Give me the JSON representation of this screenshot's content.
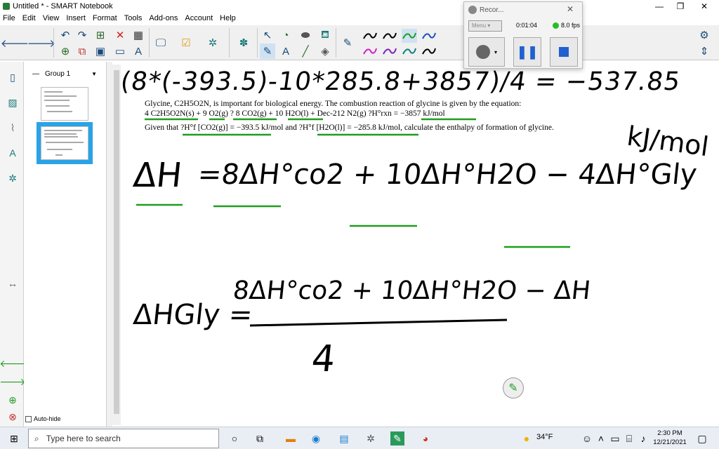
{
  "window": {
    "title": "Untitled * - SMART Notebook"
  },
  "menu": [
    "File",
    "Edit",
    "View",
    "Insert",
    "Format",
    "Tools",
    "Add-ons",
    "Account",
    "Help"
  ],
  "page_sorter": {
    "group_label": "Group 1",
    "autohide_label": "Auto-hide"
  },
  "problem": {
    "line1": "Glycine, C2H5O2N, is important for biological energy. The combustion reaction of glycine is given by the equation:",
    "line2": "4 C2H5O2N(s) + 9 O2(g) ? 8 CO2(g) + 10 H2O(l) + Dec-212 N2(g) ?H°rxn = −3857 kJ/mol",
    "line3": "Given that ?H°f [CO2(g)] = −393.5 kJ/mol and ?H°f [H2O(l)] = −285.8 kJ/mol, calculate the enthalpy of formation of glycine."
  },
  "handwriting": {
    "top_line": "(8*(-393.5)-10*285.8+3857)/4 = −537.85",
    "units": "kJ/mol",
    "eq1_lhs": "ΔH",
    "eq1_rhs": "=8ΔH°co2 + 10ΔH°H2O − 4ΔH°Gly",
    "eq2_lhs": "ΔHGly =",
    "eq2_num": "8ΔH°co2 + 10ΔH°H2O − ΔH",
    "eq2_den": "4"
  },
  "recorder": {
    "title": "Recor...",
    "menu_label": "Menu",
    "elapsed": "0:01:04",
    "fps": "8.0 fps"
  },
  "taskbar": {
    "search_placeholder": "Type here to search",
    "weather": "34°F",
    "time": "2:30 PM",
    "date": "12/21/2021"
  },
  "colors": {
    "ink": "#000000",
    "highlight_green": "#1f9d1f",
    "selection_blue": "#29a3e8"
  }
}
